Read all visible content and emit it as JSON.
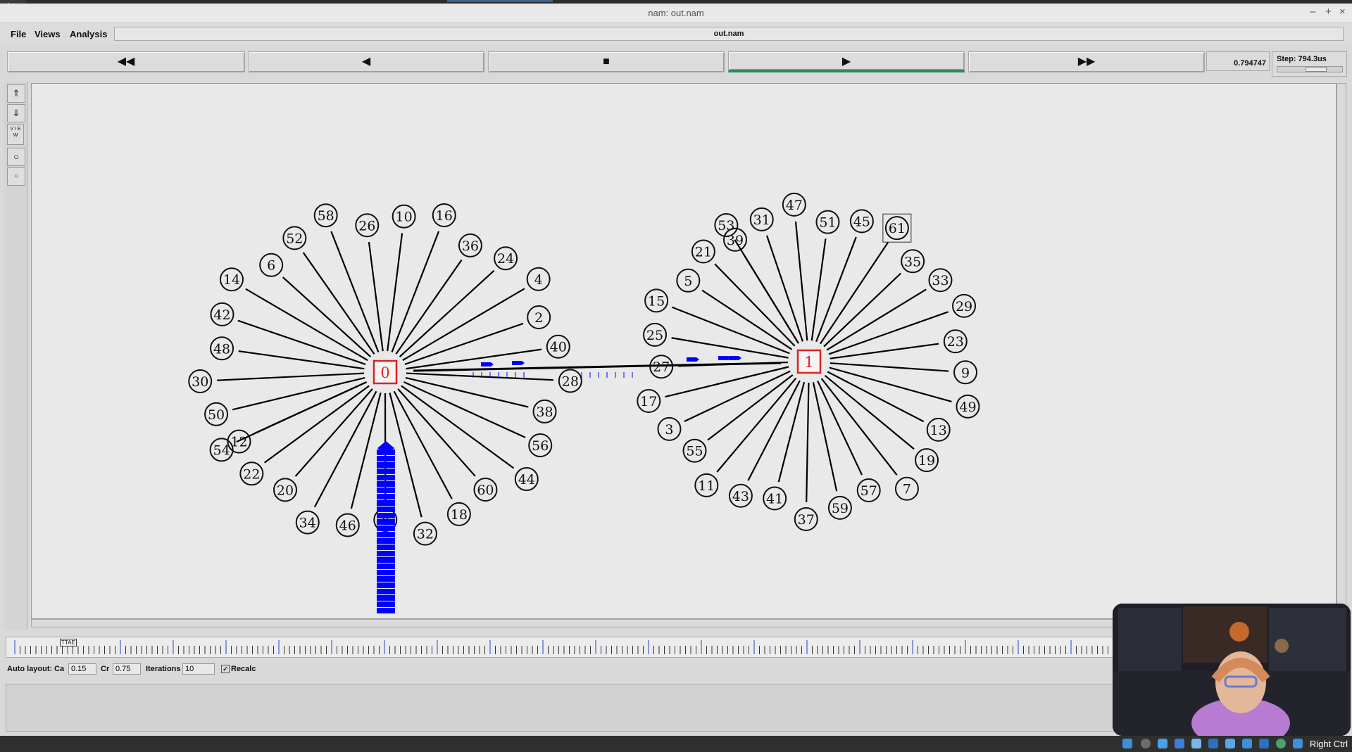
{
  "window": {
    "title": "nam: out.nam",
    "controls": [
      "–",
      "+",
      "×"
    ]
  },
  "menu": {
    "file": "File",
    "views": "Views",
    "analysis": "Analysis",
    "trace_file": "out.nam"
  },
  "playback": {
    "rewind": "◀◀",
    "back": "◀",
    "stop": "■",
    "play": "▶",
    "fast_forward": "▶▶",
    "time": "0.794747",
    "step_label": "Step: 794.3us"
  },
  "tools": {
    "view_label": "V I E W"
  },
  "timeline": {
    "marker": "TTAE"
  },
  "auto_layout": {
    "label": "Auto layout:",
    "ca_label": "Ca",
    "ca_value": "0.15",
    "cr_label": "Cr",
    "cr_value": "0.75",
    "iterations_label": "Iterations",
    "iterations_value": "10",
    "recalc_label": "Recalc",
    "recalc_checked": true
  },
  "taskbar": {
    "right_label": "Right Ctrl"
  },
  "topology": {
    "routers": [
      "0",
      "1"
    ],
    "left_leaves": [
      "12",
      "50",
      "30",
      "48",
      "42",
      "14",
      "6",
      "52",
      "58",
      "26",
      "10",
      "16",
      "36",
      "24",
      "4",
      "2",
      "40",
      "28",
      "38",
      "56",
      "44",
      "60",
      "18",
      "32",
      "8",
      "46",
      "34",
      "20",
      "22",
      "54"
    ],
    "right_leaves": [
      "39",
      "31",
      "47",
      "51",
      "45",
      "61",
      "35",
      "33",
      "29",
      "23",
      "9",
      "49",
      "13",
      "19",
      "7",
      "57",
      "59",
      "37",
      "41",
      "43",
      "11",
      "55",
      "3",
      "17",
      "27",
      "25",
      "15",
      "5",
      "21",
      "53"
    ],
    "highlighted_node": "61",
    "colors": {
      "router": "#dd2222",
      "packet": "#0000ff",
      "link": "#000000"
    }
  }
}
